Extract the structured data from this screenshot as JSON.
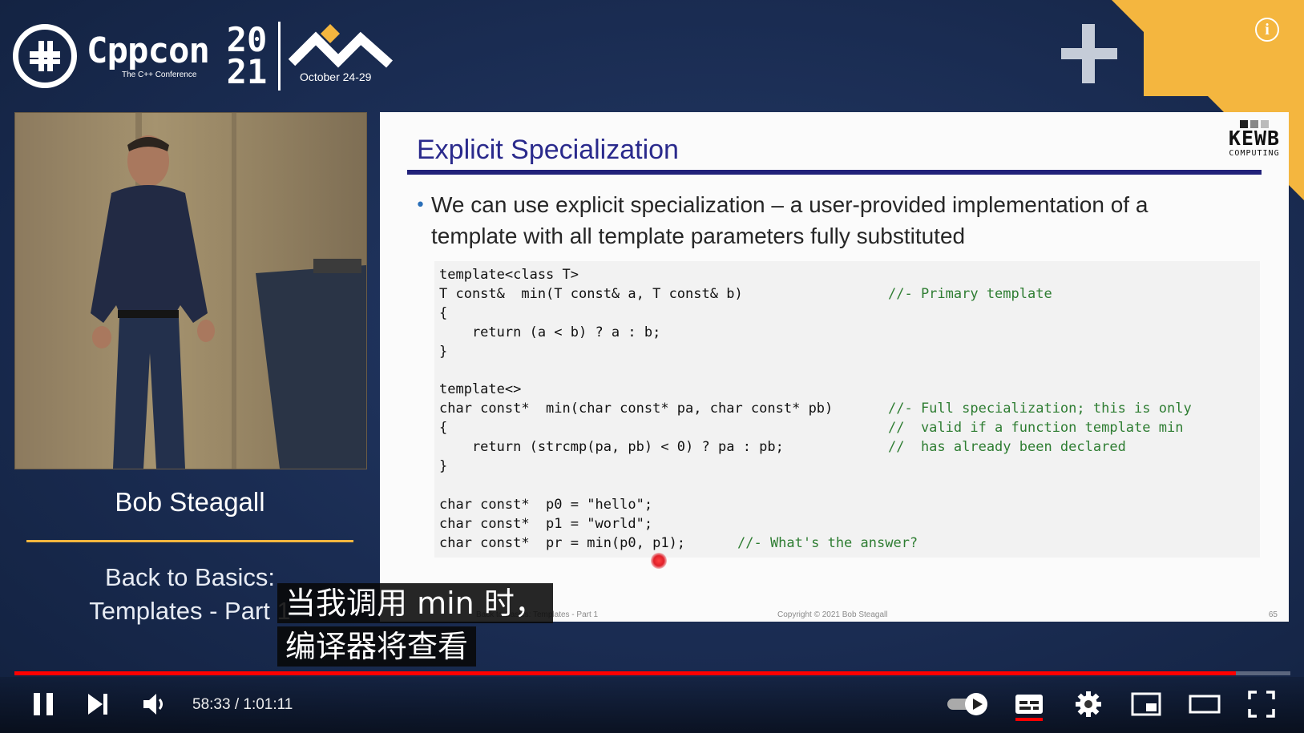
{
  "brand": {
    "name": "Cppcon",
    "tagline": "The C++ Conference",
    "year_top": "20",
    "year_bottom": "21",
    "dates": "October 24-29"
  },
  "speaker": {
    "name": "Bob Steagall",
    "talk_title_line1": "Back to Basics:",
    "talk_title_line2": "Templates - Part 1"
  },
  "slide": {
    "title": "Explicit Specialization",
    "logo_big": "KEWB",
    "logo_small": "COMPUTING",
    "bullet": "We can use explicit specialization – a user-provided implementation of a template with all template parameters fully substituted",
    "code_lines": [
      "template<class T>",
      "T const&  min(T const& a, T const& b)",
      "{",
      "    return (a < b) ? a : b;",
      "}",
      "",
      "template<>",
      "char const*  min(char const* pa, char const* pb)",
      "{",
      "    return (strcmp(pa, pb) < 0) ? pa : pb;",
      "}",
      "",
      "char const*  p0 = \"hello\";",
      "char const*  p1 = \"world\";",
      "char const*  pr = min(p0, p1);"
    ],
    "comments": {
      "primary": "//- Primary template",
      "full1": "//- Full specialization; this is only",
      "full2": "//  valid if a function template min",
      "full3": "//  has already been declared",
      "answer": "//- What's the answer?"
    },
    "footer_left": "Back to Basics: Templates - Part 1",
    "footer_center": "Copyright © 2021 Bob Steagall",
    "page_number": "65"
  },
  "captions": {
    "line1": "当我调用 min 时，",
    "line2": "编译器将查看"
  },
  "player": {
    "current_time": "58:33",
    "duration": "1:01:11",
    "time_display": "58:33 / 1:01:11",
    "progress": 0.957,
    "accent": "#ff0000",
    "icons": [
      "pause-icon",
      "next-icon",
      "volume-icon",
      "autoplay-toggle",
      "subtitles-icon",
      "settings-icon",
      "miniplayer-icon",
      "theater-icon",
      "fullscreen-icon",
      "info-icon"
    ]
  },
  "colors": {
    "background": "#1a2c52",
    "orange": "#f4b63f",
    "slide_title": "#2a2a8c",
    "comment_green": "#2e7d32"
  }
}
